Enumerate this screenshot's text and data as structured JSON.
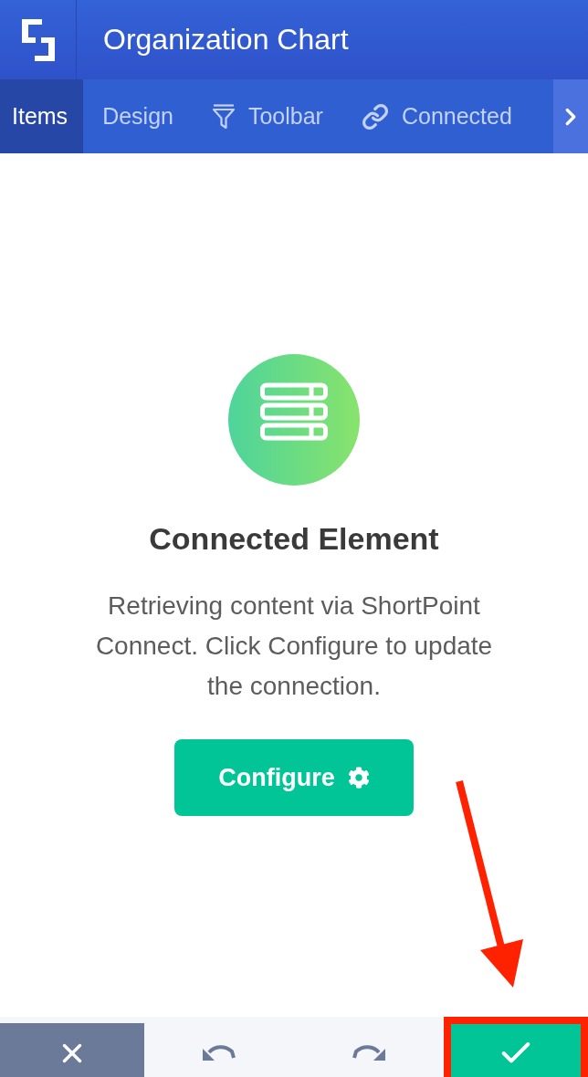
{
  "header": {
    "title": "Organization Chart"
  },
  "tabs": [
    {
      "label": "Items",
      "selected": true
    },
    {
      "label": "Design",
      "selected": false
    },
    {
      "label": "Toolbar",
      "selected": false
    },
    {
      "label": "Connected",
      "selected": false
    }
  ],
  "placeholder_card": {
    "title": "Connected Element",
    "description": "Retrieving content via ShortPoint Connect. Click Configure to update the connection.",
    "button": "Configure"
  },
  "footer": {
    "buttons": [
      {
        "kind": "cancel",
        "highlighted": false
      },
      {
        "kind": "undo",
        "highlighted": false
      },
      {
        "kind": "redo",
        "highlighted": false
      },
      {
        "kind": "confirm",
        "highlighted": true
      }
    ]
  }
}
